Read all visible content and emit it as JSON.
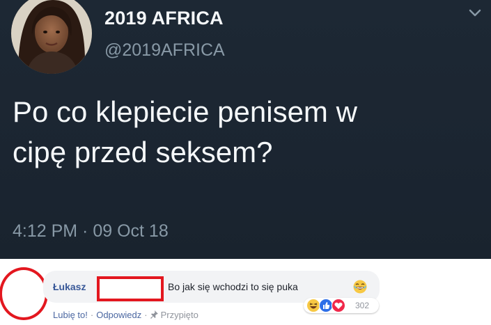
{
  "tweet": {
    "display_name": "2019 AFRICA",
    "handle": "@2019AFRICA",
    "text_line1": "Po co klepiecie penisem w",
    "text_line2": "cipę przed seksem?",
    "timestamp": "4:12 PM · 09 Oct 18",
    "background_color": "#1c2733",
    "avatar_icon": "profile-photo",
    "menu_icon": "chevron-down-icon"
  },
  "comment": {
    "author": "Łukasz",
    "text": "Bo jak się wchodzi to się puka",
    "trailing_emoji": "laughing-emoji",
    "reactions": {
      "icons": [
        "haha-reaction-icon",
        "like-reaction-icon",
        "love-reaction-icon"
      ],
      "count": "302"
    },
    "actions": {
      "like": "Lubię to!",
      "reply": "Odpowiedz",
      "pinned": "Przypięto"
    },
    "annotation_color": "#e3171f"
  }
}
